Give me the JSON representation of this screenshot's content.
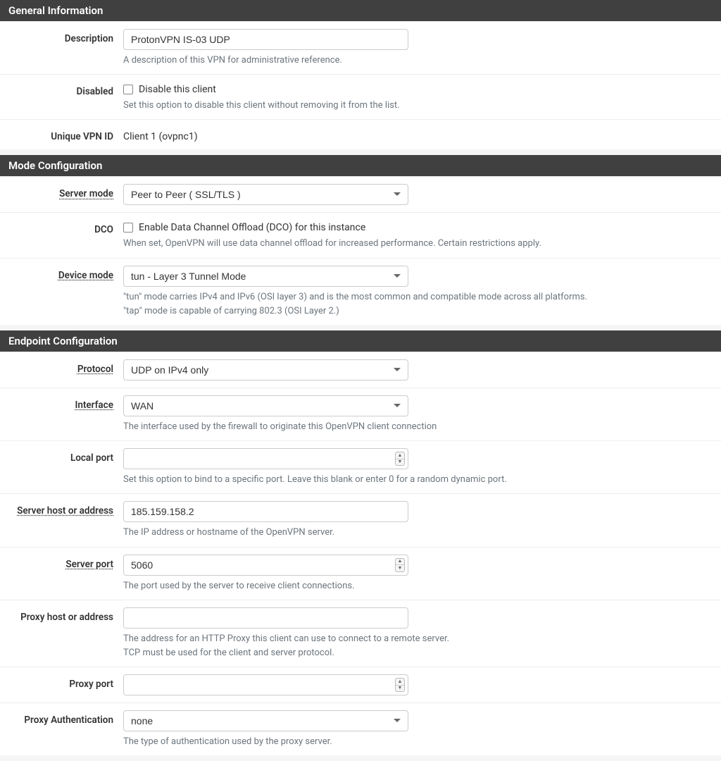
{
  "general": {
    "title": "General Information",
    "description": {
      "label": "Description",
      "value": "ProtonVPN IS-03 UDP",
      "help": "A description of this VPN for administrative reference."
    },
    "disabled": {
      "label": "Disabled",
      "checkbox_label": "Disable this client",
      "help": "Set this option to disable this client without removing it from the list."
    },
    "unique_vpn_id": {
      "label": "Unique VPN ID",
      "value": "Client 1 (ovpnc1)"
    }
  },
  "mode": {
    "title": "Mode Configuration",
    "server_mode": {
      "label": "Server mode",
      "value": "Peer to Peer ( SSL/TLS )"
    },
    "dco": {
      "label": "DCO",
      "checkbox_label": "Enable Data Channel Offload (DCO) for this instance",
      "help": "When set, OpenVPN will use data channel offload for increased performance. Certain restrictions apply."
    },
    "device_mode": {
      "label": "Device mode",
      "value": "tun - Layer 3 Tunnel Mode",
      "help1": "\"tun\" mode carries IPv4 and IPv6 (OSI layer 3) and is the most common and compatible mode across all platforms.",
      "help2": "\"tap\" mode is capable of carrying 802.3 (OSI Layer 2.)"
    }
  },
  "endpoint": {
    "title": "Endpoint Configuration",
    "protocol": {
      "label": "Protocol",
      "value": "UDP on IPv4 only"
    },
    "interface": {
      "label": "Interface",
      "value": "WAN",
      "help": "The interface used by the firewall to originate this OpenVPN client connection"
    },
    "local_port": {
      "label": "Local port",
      "value": "",
      "help": "Set this option to bind to a specific port. Leave this blank or enter 0 for a random dynamic port."
    },
    "server_host": {
      "label": "Server host or address",
      "value": "185.159.158.2",
      "help": "The IP address or hostname of the OpenVPN server."
    },
    "server_port": {
      "label": "Server port",
      "value": "5060",
      "help": "The port used by the server to receive client connections."
    },
    "proxy_host": {
      "label": "Proxy host or address",
      "value": "",
      "help1": "The address for an HTTP Proxy this client can use to connect to a remote server.",
      "help2": "TCP must be used for the client and server protocol."
    },
    "proxy_port": {
      "label": "Proxy port",
      "value": ""
    },
    "proxy_auth": {
      "label": "Proxy Authentication",
      "value": "none",
      "help": "The type of authentication used by the proxy server."
    }
  }
}
